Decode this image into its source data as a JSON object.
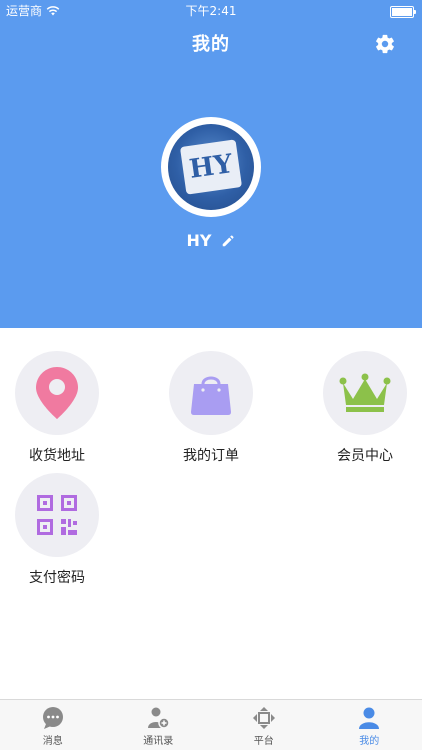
{
  "status_bar": {
    "carrier": "运营商",
    "time": "下午2:41"
  },
  "header": {
    "title": "我的"
  },
  "profile": {
    "name": "HY",
    "avatar_text": "HY"
  },
  "menu": [
    {
      "label": "收货地址",
      "icon": "location-pin-icon"
    },
    {
      "label": "我的订单",
      "icon": "shopping-bag-icon"
    },
    {
      "label": "会员中心",
      "icon": "crown-icon"
    },
    {
      "label": "支付密码",
      "icon": "qr-code-icon"
    }
  ],
  "tabbar": [
    {
      "label": "消息",
      "icon": "chat-bubble-icon"
    },
    {
      "label": "通讯录",
      "icon": "contacts-icon"
    },
    {
      "label": "平台",
      "icon": "platform-diamond-icon"
    },
    {
      "label": "我的",
      "icon": "user-icon",
      "active": true
    }
  ],
  "colors": {
    "header_bg": "#5b9bef",
    "tab_active": "#4a8be6",
    "location_pin": "#f07aa0",
    "bag": "#a99df2",
    "crown": "#8cc14a",
    "qr": "#b06be0"
  }
}
